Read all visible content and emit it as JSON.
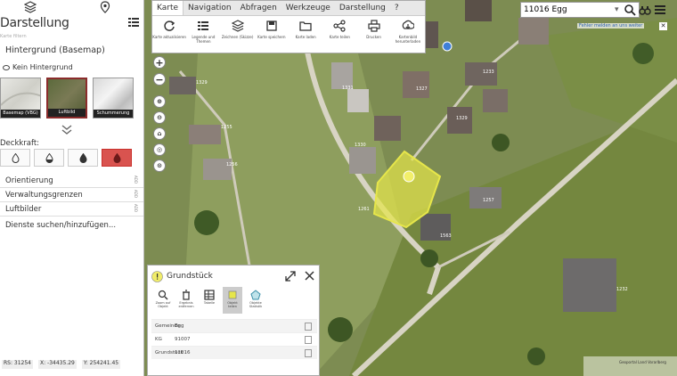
{
  "sidebar": {
    "title": "Darstellung",
    "subtitle": "Karte filtern",
    "section": "Hintergrund (Basemap)",
    "no_background": "Kein Hintergrund",
    "thumbs": [
      {
        "label": "Basemap (VBG)"
      },
      {
        "label": "Luftbild"
      },
      {
        "label": "Schummerung"
      }
    ],
    "opacity_label": "Deckkraft:",
    "layers": [
      {
        "label": "Orientierung",
        "side": "ADD"
      },
      {
        "label": "Verwaltungsgrenzen",
        "side": "ADD"
      },
      {
        "label": "Luftbilder",
        "side": "ADD"
      }
    ],
    "search_services": "Dienste suchen/hinzufügen...",
    "footer": [
      "RS: 31254",
      "X: -34435.29",
      "Y: 254241.45"
    ]
  },
  "toolbar": {
    "tabs": [
      "Karte",
      "Navigation",
      "Abfragen",
      "Werkzeuge",
      "Darstellung",
      "?"
    ],
    "tools": [
      {
        "label": "Karte aktualisieren",
        "icon": "refresh-icon"
      },
      {
        "label": "Legende und Themen",
        "icon": "legend-icon"
      },
      {
        "label": "Zeichnen (Skizze)",
        "icon": "layers-icon"
      },
      {
        "label": "Karte speichern",
        "icon": "save-icon"
      },
      {
        "label": "Karte laden",
        "icon": "folder-icon"
      },
      {
        "label": "Karte teilen",
        "icon": "share-icon"
      },
      {
        "label": "Drucken",
        "icon": "print-icon"
      },
      {
        "label": "Kartenbild herunterladen",
        "icon": "download-icon"
      }
    ]
  },
  "search": {
    "value": "11016 Egg",
    "report": "Fehler melden an uns weiter"
  },
  "panel": {
    "title": "Grundstück",
    "tools": [
      {
        "label": "Zoom auf Objekt",
        "icon": "zoom-icon"
      },
      {
        "label": "Ergebnis entfernen",
        "icon": "trash-icon"
      },
      {
        "label": "Tabelle",
        "icon": "table-icon"
      },
      {
        "label": "Objekt teilen",
        "icon": "layer-icon"
      },
      {
        "label": "Objekte Statistik",
        "icon": "polygon-icon"
      }
    ],
    "rows": [
      {
        "key": "Gemeinde",
        "value": "Egg"
      },
      {
        "key": "KG",
        "value": "91007"
      },
      {
        "key": "Grundstück",
        "value": "11016"
      }
    ]
  },
  "map": {
    "parcel_labels": [
      "1329",
      "1331",
      "1255",
      "1256",
      "1327",
      "1329",
      "1261",
      "1563",
      "1257",
      "1233",
      "1232",
      "1330"
    ],
    "logo_text": "Geoportal Land Vorarlberg"
  },
  "colors": {
    "accent_red": "#d9534f",
    "parcel_yellow": "#e6e64a",
    "selected_border": "#8b2c2c"
  }
}
